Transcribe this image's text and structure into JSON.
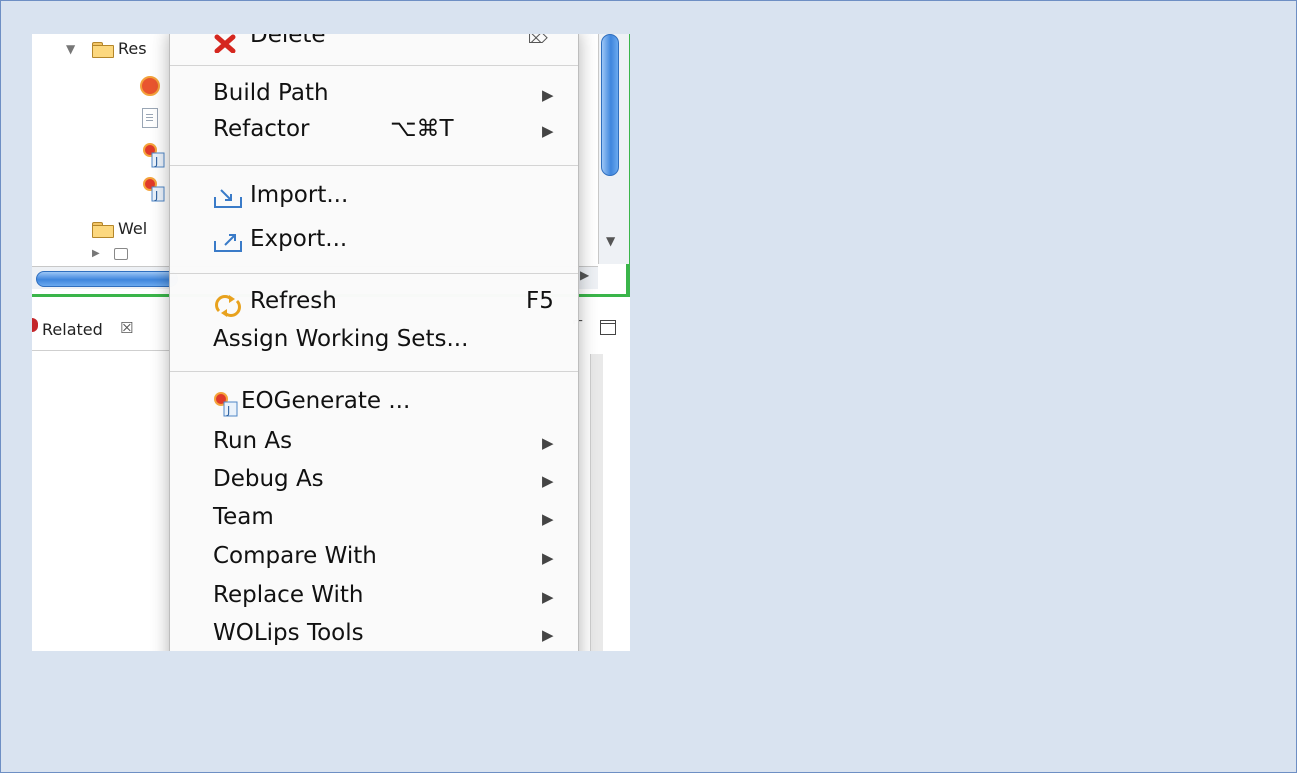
{
  "explorer": {
    "tree": [
      {
        "label": "Res",
        "expanded": true
      },
      {
        "label": "Wel",
        "expanded": false
      }
    ],
    "related_tab_label": "Related"
  },
  "menu": {
    "delete_label": "Delete",
    "build_path_label": "Build Path",
    "refactor_label": "Refactor",
    "refactor_shortcut": "⌥⌘T",
    "import_label": "Import...",
    "export_label": "Export...",
    "refresh_label": "Refresh",
    "refresh_shortcut": "F5",
    "assign_working_sets_label": "Assign Working Sets...",
    "eogenerate_label": "EOGenerate ...",
    "run_as_label": "Run As",
    "debug_as_label": "Debug As",
    "team_label": "Team",
    "compare_with_label": "Compare With",
    "replace_with_label": "Replace With",
    "wolips_tools_label": "WOLips Tools"
  },
  "colors": {
    "page_background": "#d9e3f0",
    "selection_green": "#3ab54a",
    "scroll_thumb_blue": "#3f86dd"
  }
}
